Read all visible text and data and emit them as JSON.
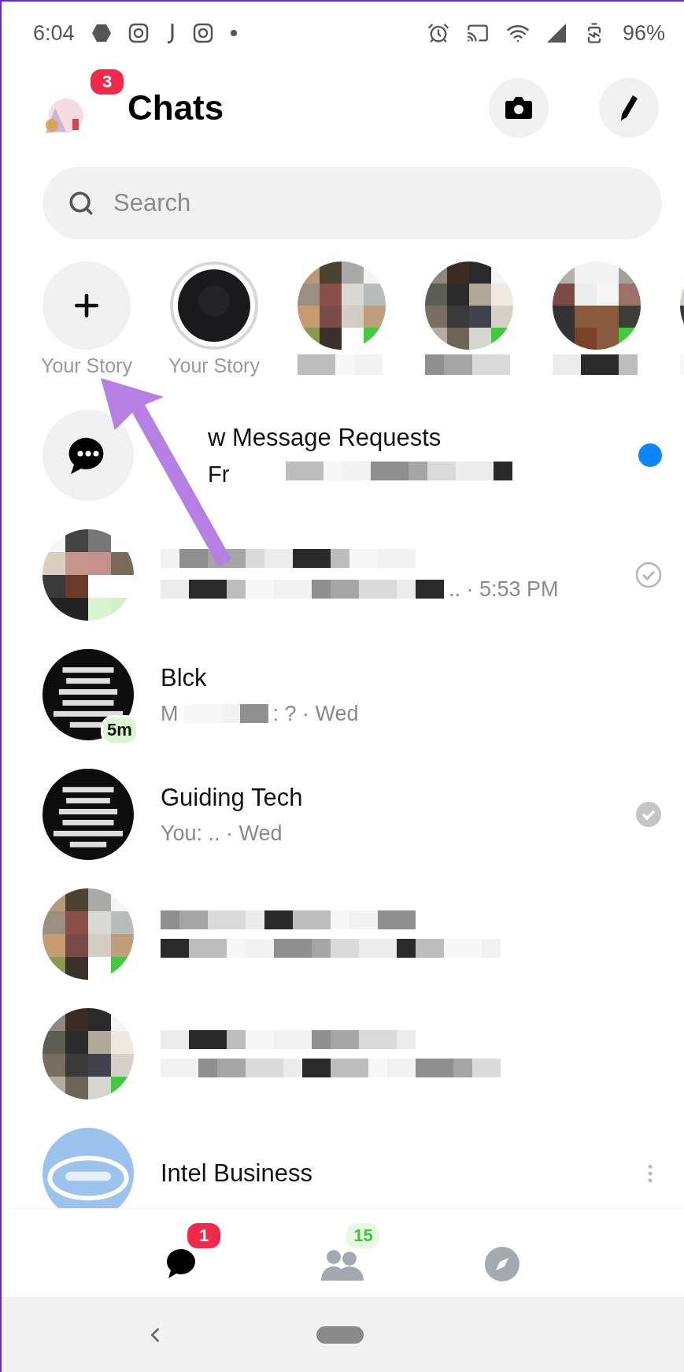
{
  "status_bar": {
    "time": "6:04",
    "battery": "96%"
  },
  "header": {
    "title": "Chats",
    "badge": "3"
  },
  "search": {
    "placeholder": "Search"
  },
  "stories": [
    {
      "kind": "add",
      "label": "Your Story"
    },
    {
      "kind": "own",
      "label": "Your Story"
    },
    {
      "kind": "friend"
    },
    {
      "kind": "friend"
    },
    {
      "kind": "friend"
    },
    {
      "kind": "friend"
    }
  ],
  "requests": {
    "title": "w Message Requests",
    "subtitle": "Fr",
    "unread": true
  },
  "chats": [
    {
      "preview": ".. · 5:53 PM",
      "preview_redacted": true,
      "sent": true,
      "delivered": false,
      "options": false
    },
    {
      "name": "Blck",
      "preview_lead": "M",
      "preview": ": ? · Wed",
      "preview_redacted": true,
      "badge": "5m",
      "sent": false,
      "delivered": false,
      "options": false
    },
    {
      "name": "Guiding Tech",
      "preview": "You: .. · Wed",
      "preview_redacted": false,
      "sent": false,
      "delivered": true,
      "options": false
    },
    {
      "preview_redacted": true,
      "sent": false,
      "delivered": false,
      "options": false
    },
    {
      "preview_redacted": true,
      "sent": false,
      "delivered": false,
      "options": false
    },
    {
      "name": "Intel Business",
      "preview_redacted": false,
      "sent": false,
      "delivered": false,
      "options": true
    }
  ],
  "nav": [
    {
      "kind": "chats",
      "selected": true,
      "badge": "1"
    },
    {
      "kind": "people",
      "selected": false,
      "badge": "15"
    },
    {
      "kind": "discover",
      "selected": false
    }
  ]
}
